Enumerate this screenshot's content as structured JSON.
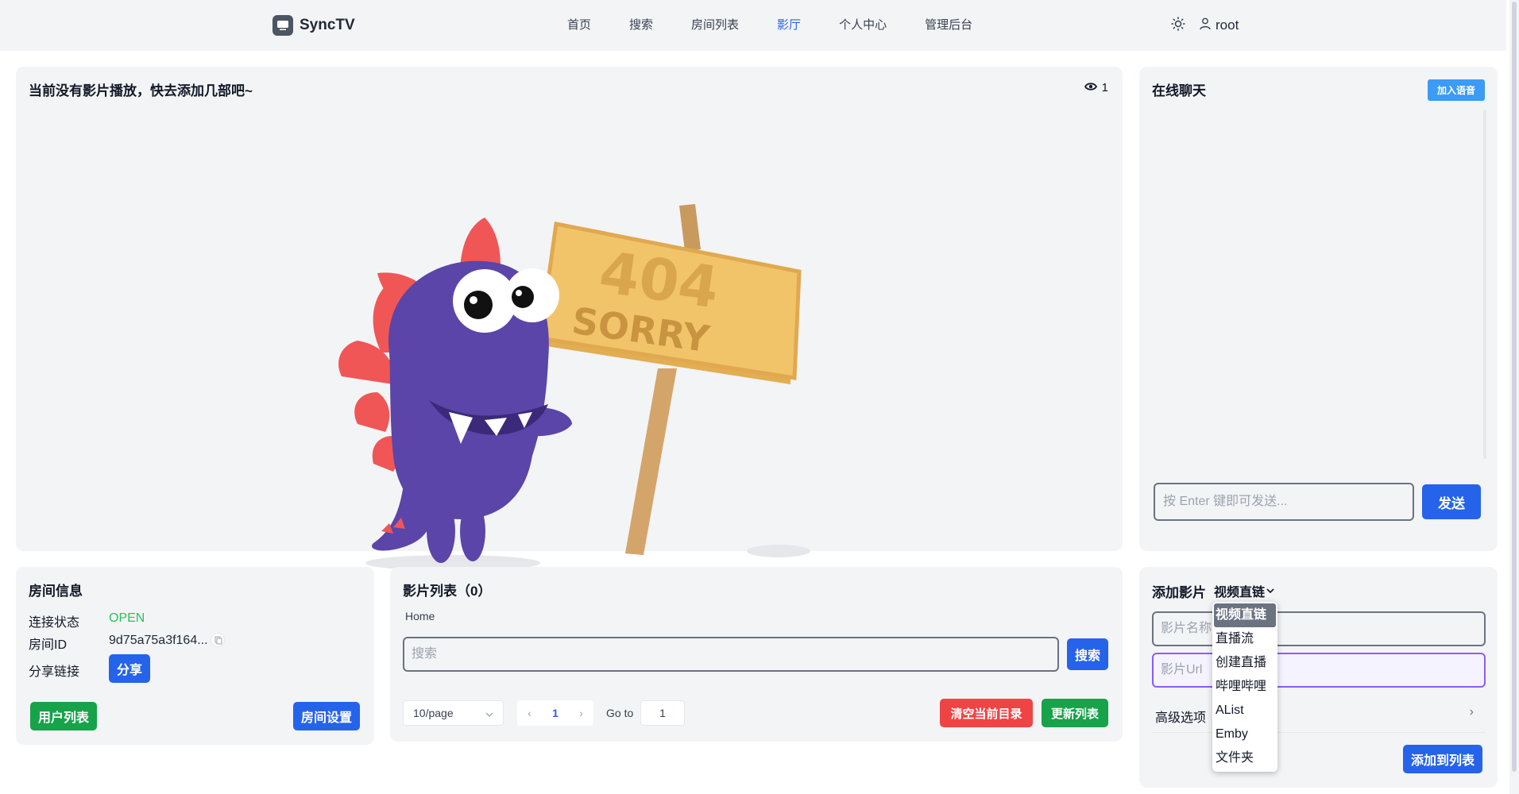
{
  "brand": {
    "name": "SyncTV"
  },
  "nav": {
    "items": [
      {
        "label": "首页",
        "active": false
      },
      {
        "label": "搜索",
        "active": false
      },
      {
        "label": "房间列表",
        "active": false
      },
      {
        "label": "影厅",
        "active": true
      },
      {
        "label": "个人中心",
        "active": false
      },
      {
        "label": "管理后台",
        "active": false
      }
    ],
    "theme_icon": "sun-icon",
    "user_icon": "user-icon",
    "username": "root"
  },
  "player": {
    "title": "当前没有影片播放，快去添加几部吧~",
    "viewers": "1",
    "viewers_icon": "eye-icon",
    "sign_top": "404",
    "sign_bottom": "SORRY"
  },
  "chat": {
    "title": "在线聊天",
    "voice_button": "加入语音",
    "input_placeholder": "按 Enter 键即可发送...",
    "send_button": "发送"
  },
  "room": {
    "title": "房间信息",
    "status_label": "连接状态",
    "status_value": "OPEN",
    "id_label": "房间ID",
    "id_value": "9d75a75a3f164...",
    "share_label": "分享链接",
    "share_button": "分享",
    "user_list_button": "用户列表",
    "settings_button": "房间设置"
  },
  "movies": {
    "title": "影片列表（0）",
    "breadcrumb": "Home",
    "search_placeholder": "搜索",
    "search_button": "搜索",
    "page_size": "10/page",
    "current_page": "1",
    "goto_label": "Go to",
    "goto_value": "1",
    "clear_button": "清空当前目录",
    "refresh_button": "更新列表"
  },
  "add_movie": {
    "title": "添加影片",
    "selected_type": "视频直链",
    "name_placeholder": "影片名称",
    "url_placeholder": "影片Url",
    "advanced_label": "高级选项",
    "add_button": "添加到列表",
    "type_options": [
      "视频直链",
      "直播流",
      "创建直播",
      "哔哩哔哩",
      "AList",
      "Emby",
      "文件夹"
    ]
  },
  "colors": {
    "primary": "#2563eb",
    "success": "#16a34a",
    "danger": "#ef4444",
    "status_open": "#22c55e",
    "monster": "#5b45a8",
    "spikes": "#f05656",
    "sign": "#f2c46a"
  }
}
